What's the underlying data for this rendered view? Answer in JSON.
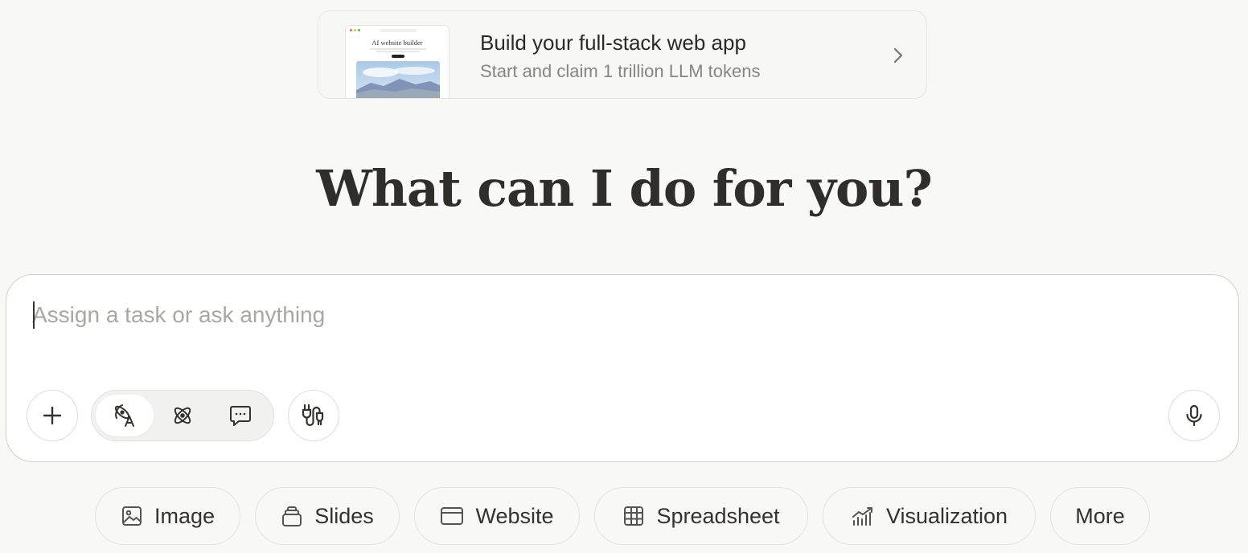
{
  "promo": {
    "title": "Build your full-stack web app",
    "subtitle": "Start and claim 1 trillion LLM tokens",
    "thumbnail_title": "AI website builder"
  },
  "heading": "What can I do for you?",
  "composer": {
    "placeholder": "Assign a task or ask anything",
    "value": ""
  },
  "quick_actions": [
    {
      "label": "Image",
      "icon": "image-icon"
    },
    {
      "label": "Slides",
      "icon": "slides-icon"
    },
    {
      "label": "Website",
      "icon": "website-icon"
    },
    {
      "label": "Spreadsheet",
      "icon": "spreadsheet-icon"
    },
    {
      "label": "Visualization",
      "icon": "chart-icon"
    },
    {
      "label": "More",
      "icon": ""
    }
  ],
  "colors": {
    "background": "#f8f8f7",
    "text": "#34322d",
    "muted": "#86857f",
    "border": "#e2e2df"
  }
}
